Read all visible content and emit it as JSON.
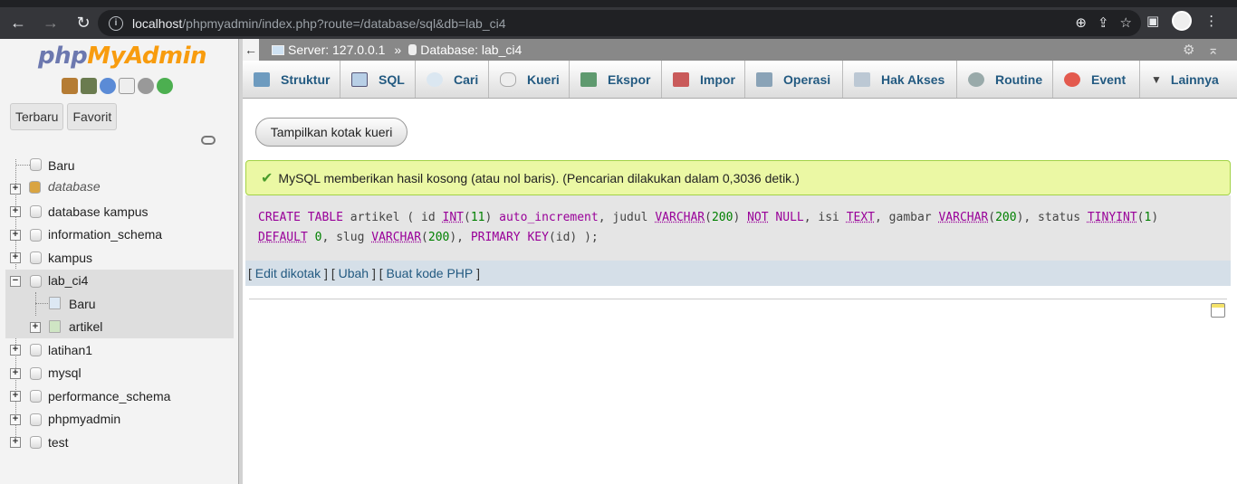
{
  "browser": {
    "url_host": "localhost",
    "url_path": "/phpmyadmin/index.php?route=/database/sql&db=lab_ci4"
  },
  "sidebar": {
    "logo_php": "php",
    "logo_my": "My",
    "logo_admin": "Admin",
    "recent_label": "Terbaru",
    "favorite_label": "Favorit",
    "tree": {
      "new": "Baru",
      "db_database": "database",
      "db_database_kampus": "database kampus",
      "db_information_schema": "information_schema",
      "db_kampus": "kampus",
      "db_lab_ci4": "lab_ci4",
      "lab_new": "Baru",
      "lab_artikel": "artikel",
      "db_latihan1": "latihan1",
      "db_mysql": "mysql",
      "db_performance_schema": "performance_schema",
      "db_phpmyadmin": "phpmyadmin",
      "db_test": "test"
    }
  },
  "topbar": {
    "server": "Server: 127.0.0.1",
    "separator": "»",
    "database": "Database: lab_ci4"
  },
  "tabs": [
    {
      "label": "Struktur",
      "icon": "structure-icon"
    },
    {
      "label": "SQL",
      "icon": "sql-icon"
    },
    {
      "label": "Cari",
      "icon": "search-icon"
    },
    {
      "label": "Kueri",
      "icon": "query-icon"
    },
    {
      "label": "Ekspor",
      "icon": "export-icon"
    },
    {
      "label": "Impor",
      "icon": "import-icon"
    },
    {
      "label": "Operasi",
      "icon": "operations-icon"
    },
    {
      "label": "Hak Akses",
      "icon": "privileges-icon"
    },
    {
      "label": "Routine",
      "icon": "routines-icon"
    },
    {
      "label": "Event",
      "icon": "events-icon"
    },
    {
      "label": "Lainnya",
      "icon": "more-icon"
    }
  ],
  "main": {
    "show_query_box": "Tampilkan kotak kueri",
    "success_message": "MySQL memberikan hasil kosong (atau nol baris). (Pencarian dilakukan dalam 0,3036 detik.)",
    "sql_links": {
      "edit_inline": "Edit dikotak",
      "edit": "Ubah",
      "create_php": "Buat kode PHP"
    }
  },
  "colors": {
    "success_bg": "#ebf8a4",
    "tab_text": "#235a81",
    "sql_keyword": "#990099"
  }
}
